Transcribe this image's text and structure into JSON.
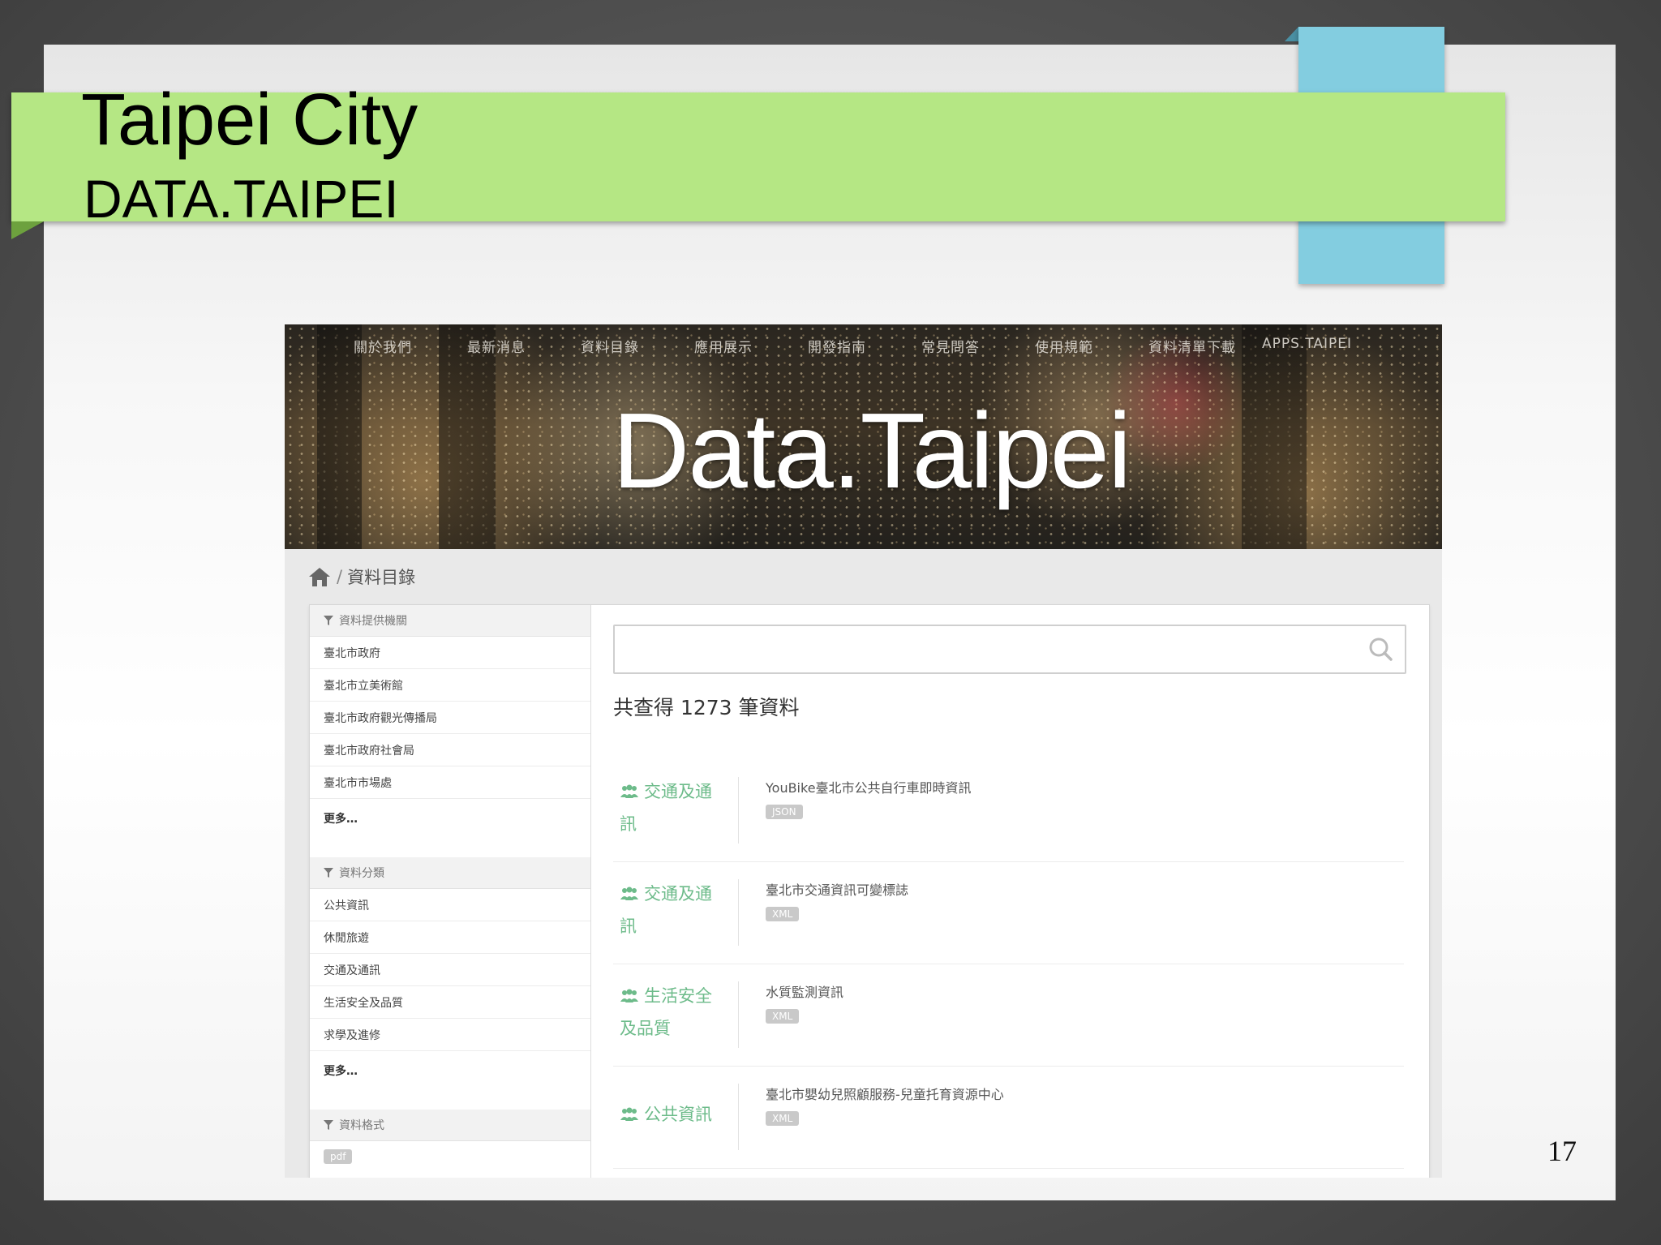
{
  "slide": {
    "title": "Taipei City",
    "subtitle": "DATA.TAIPEI",
    "page_number": "17",
    "colors": {
      "green_band": "#b5e784",
      "blue_box": "#83cde0"
    }
  },
  "site": {
    "nav": [
      "關於我們",
      "最新消息",
      "資料目錄",
      "應用展示",
      "開發指南",
      "常見問答",
      "使用規範",
      "資料清單下載",
      "APPS.TAIPEI"
    ],
    "brand": "Data.Taipei",
    "breadcrumb": {
      "home_icon": "home-icon",
      "separator": "/",
      "current": "資料目錄"
    },
    "sidebar": {
      "org": {
        "heading": "資料提供機關",
        "items": [
          "臺北市政府",
          "臺北市立美術館",
          "臺北市政府觀光傳播局",
          "臺北市政府社會局",
          "臺北市市場處"
        ],
        "more": "更多…"
      },
      "category": {
        "heading": "資料分類",
        "items": [
          "公共資訊",
          "休閒旅遊",
          "交通及通訊",
          "生活安全及品質",
          "求學及進修"
        ],
        "more": "更多…"
      },
      "format": {
        "heading": "資料格式",
        "items": [
          "pdf"
        ]
      }
    },
    "search": {
      "placeholder": "",
      "icon": "search-icon"
    },
    "result_count": "共查得 1273 筆資料",
    "results": [
      {
        "category": "交通及通訊",
        "title": "YouBike臺北市公共自行車即時資訊",
        "format": "JSON"
      },
      {
        "category": "交通及通訊",
        "title": "臺北市交通資訊可變標誌",
        "format": "XML"
      },
      {
        "category": "生活安全及品質",
        "title": "水質監測資訊",
        "format": "XML"
      },
      {
        "category": "公共資訊",
        "title": "臺北市嬰幼兒照顧服務-兒童托育資源中心",
        "format": "XML"
      }
    ],
    "colors": {
      "category_text": "#6dbb8a",
      "tag_bg": "#c9c9c9"
    }
  }
}
